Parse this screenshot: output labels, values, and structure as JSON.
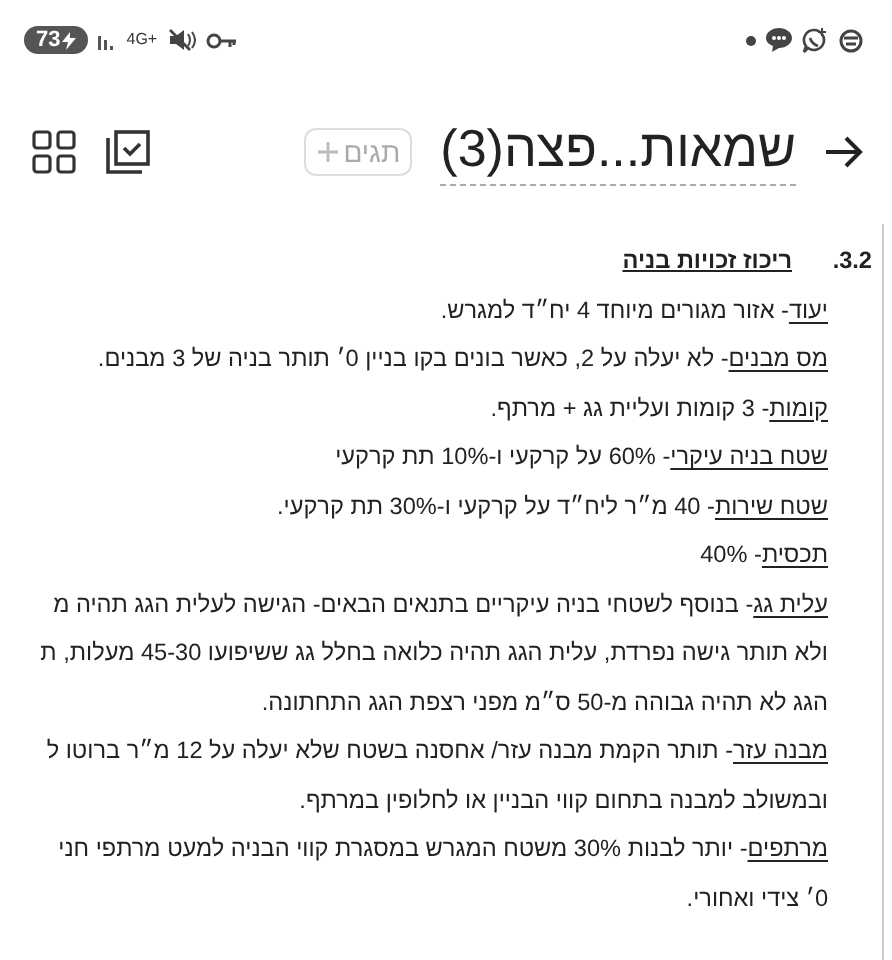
{
  "status_bar": {
    "battery": "73",
    "network": "4G+"
  },
  "toolbar": {
    "title": "שמאות...פצה(3)",
    "tags_button": "תגים"
  },
  "document": {
    "number": "3.2.",
    "heading": "ריכוז זכויות בניה",
    "paragraphs": [
      {
        "label": "יעוד",
        "text": "- אזור מגורים מיוחד 4 יח״ד למגרש."
      },
      {
        "label": "מס מבנים",
        "text": "- לא יעלה על 2, כאשר בונים בקו בניין 0׳ תותר בניה של 3 מבנים."
      },
      {
        "label": "קומות",
        "text": "- 3 קומות ועליית גג + מרתף."
      },
      {
        "label": "שטח בניה עיקרי",
        "text": "- 60% על קרקעי ו-10% תת קרקעי"
      },
      {
        "label": "שטח שירות",
        "text": "- 40 מ״ר ליח״ד על קרקעי ו-30% תת קרקעי."
      },
      {
        "label": "תכסית",
        "text": "- 40%"
      },
      {
        "label": "עלית גג",
        "text": "- בנוסף לשטחי בניה עיקריים בתנאים הבאים- הגישה לעלית הגג תהיה מ",
        "more": [
          "ולא תותר גישה נפרדת, עלית הגג תהיה כלואה בחלל גג ששיפועו 45-30 מעלות, ת",
          "הגג לא תהיה גבוהה מ-50 ס״מ מפני רצפת הגג התחתונה."
        ]
      },
      {
        "label": "מבנה עזר",
        "text": "- תותר הקמת מבנה עזר/ אחסנה בשטח שלא יעלה על 12 מ״ר ברוטו ל",
        "more": [
          "ובמשולב למבנה בתחום קווי הבניין או לחלופין במרתף."
        ]
      },
      {
        "label": "מרתפים",
        "text": "- יותר לבנות 30% משטח המגרש במסגרת קווי הבניה למעט מרתפי חני",
        "more": [
          "0׳ צידי ואחורי."
        ]
      }
    ]
  }
}
